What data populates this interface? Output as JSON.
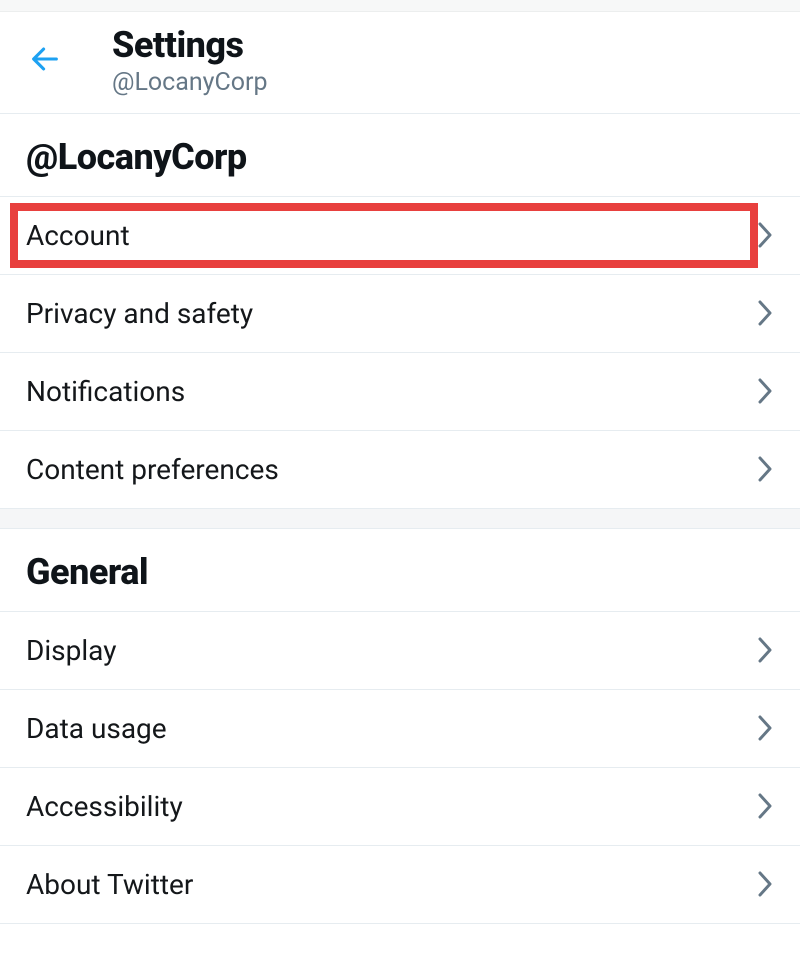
{
  "header": {
    "title": "Settings",
    "subtitle": "@LocanyCorp"
  },
  "sections": {
    "user": {
      "title": "@LocanyCorp",
      "items": [
        {
          "label": "Account",
          "highlighted": true
        },
        {
          "label": "Privacy and safety"
        },
        {
          "label": "Notifications"
        },
        {
          "label": "Content preferences"
        }
      ]
    },
    "general": {
      "title": "General",
      "items": [
        {
          "label": "Display"
        },
        {
          "label": "Data usage"
        },
        {
          "label": "Accessibility"
        },
        {
          "label": "About Twitter"
        }
      ]
    }
  }
}
